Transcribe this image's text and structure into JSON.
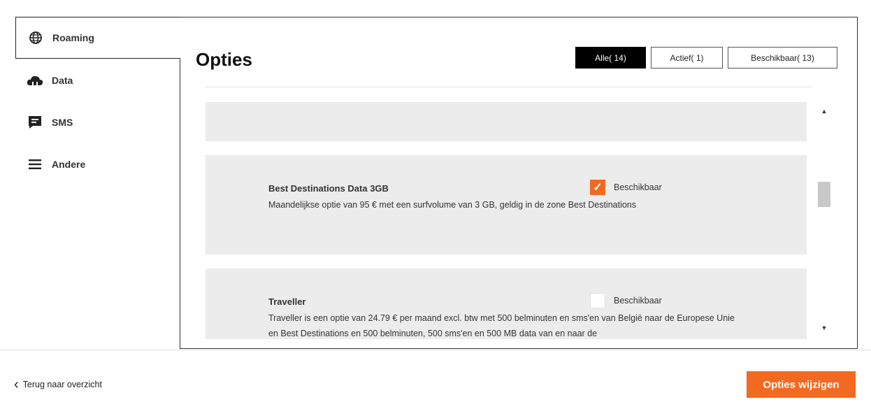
{
  "sidebar": {
    "items": [
      {
        "label": "Roaming",
        "icon": "globe-icon",
        "active": true
      },
      {
        "label": "Data",
        "icon": "cloud-icon",
        "active": false
      },
      {
        "label": "SMS",
        "icon": "message-icon",
        "active": false
      },
      {
        "label": "Andere",
        "icon": "menu-icon",
        "active": false
      }
    ]
  },
  "main": {
    "title": "Opties",
    "filters": [
      {
        "label": "Alle( 14)",
        "selected": true
      },
      {
        "label": "Actief( 1)",
        "selected": false
      },
      {
        "label": "Beschikbaar( 13)",
        "selected": false
      }
    ],
    "options": [
      {
        "title": "Best Destinations Data 3GB",
        "description": "Maandelijkse optie van 95 € met een surfvolume van 3 GB, geldig in de zone Best Destinations",
        "status": "Beschikbaar",
        "checked": true
      },
      {
        "title": "Traveller",
        "description": "Traveller is een optie van 24.79 € per maand excl. btw met 500 belminuten en sms'en van België naar de Europese Unie en Best Destinations en 500 belminuten, 500 sms'en en 500 MB data van en naar de",
        "status": "Beschikbaar",
        "checked": false
      }
    ]
  },
  "footer": {
    "back_label": "Terug naar overzicht",
    "primary_label": "Opties wijzigen"
  },
  "colors": {
    "accent": "#f26a21",
    "selected_filter": "#000000",
    "card_bg": "#ececec"
  }
}
